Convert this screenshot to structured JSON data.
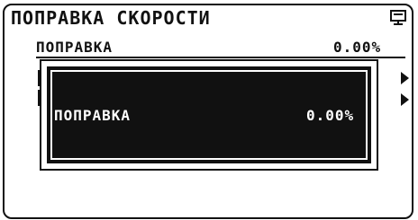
{
  "screen": {
    "title": "ПОПРАВКА СКОРОСТИ",
    "icons": {
      "display": "monitor-icon"
    }
  },
  "menu": {
    "row1": {
      "label": "ПОПРАВКА",
      "value": "0.00%"
    }
  },
  "popup": {
    "label": "ПОПРАВКА",
    "value": "0.00%"
  }
}
